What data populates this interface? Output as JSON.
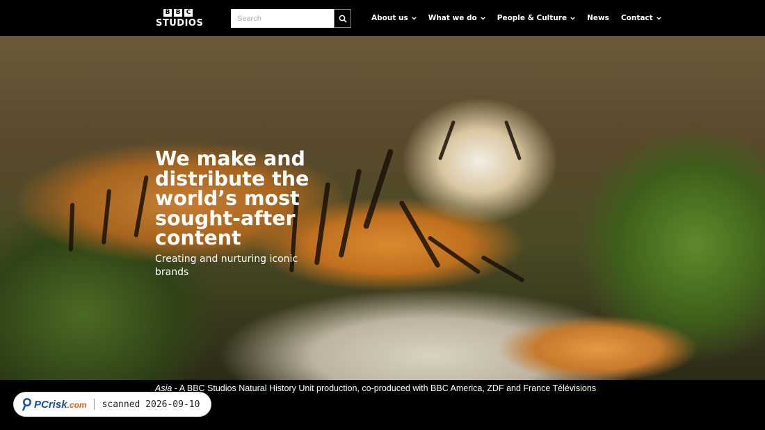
{
  "header": {
    "logo": {
      "blocks": [
        "B",
        "B",
        "C"
      ],
      "wordmark": "STUDIOS"
    },
    "search": {
      "placeholder": "Search"
    },
    "nav": [
      {
        "label": "About us",
        "has_dropdown": true
      },
      {
        "label": "What we do",
        "has_dropdown": true
      },
      {
        "label": "People & Culture",
        "has_dropdown": true
      },
      {
        "label": "News",
        "has_dropdown": false
      },
      {
        "label": "Contact",
        "has_dropdown": true
      }
    ]
  },
  "hero": {
    "title": "We make and distribute the world’s most sought-after content",
    "subtitle": "Creating and nurturing iconic brands",
    "image_subject": "tiger-lying-on-rock"
  },
  "caption": {
    "show_title": "Asia",
    "text": " - A BBC Studios Natural History Unit production, co-produced with BBC America, ZDF and France Télévisions"
  },
  "badge": {
    "brand": "PC",
    "brand_rest": "risk",
    "brand_domain": ".com",
    "text": "scanned 2026-09-10"
  },
  "colors": {
    "background": "#000000",
    "text": "#ffffff",
    "badge_brand": "#1a4fa0",
    "badge_accent": "#e0601a"
  },
  "icons": {
    "search": "search-icon",
    "chevron": "chevron-down-icon",
    "badge_logo": "magnifier-icon"
  }
}
